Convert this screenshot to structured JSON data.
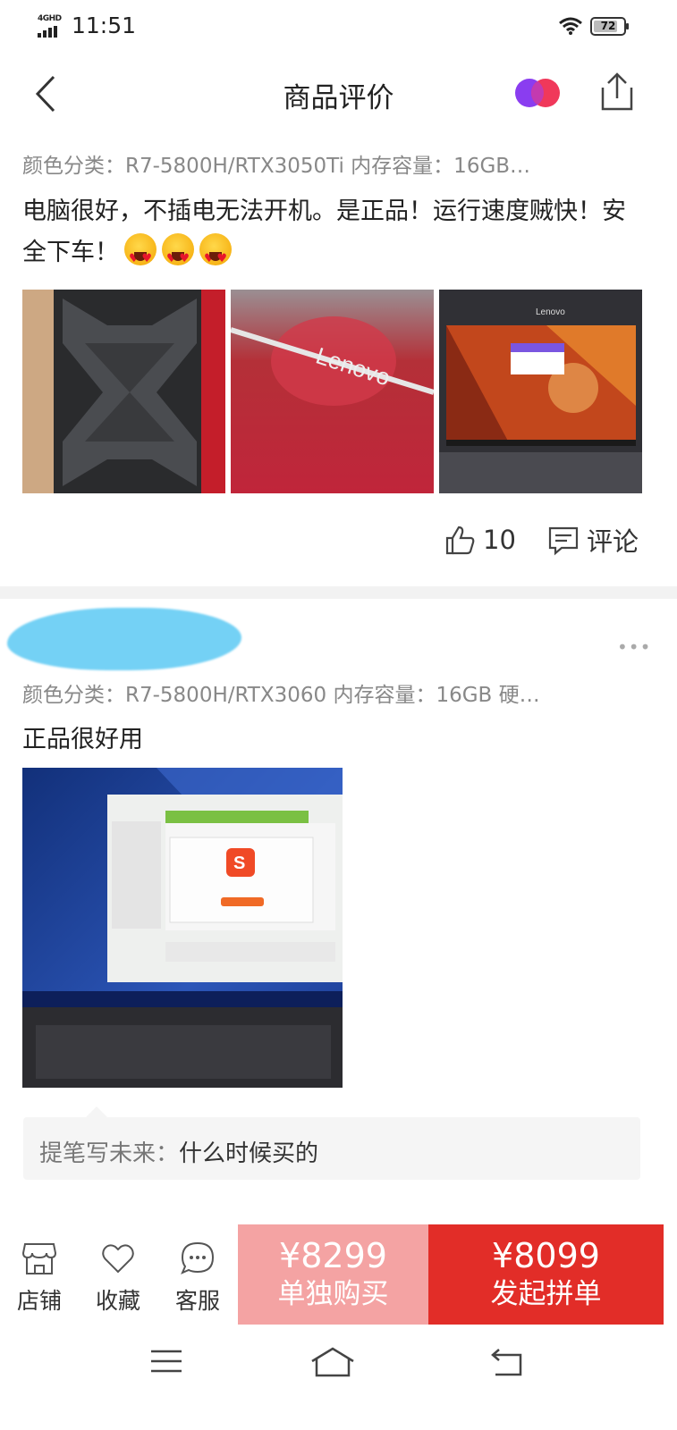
{
  "status": {
    "network": "4GHD",
    "time": "11:51",
    "battery": "72"
  },
  "header": {
    "title": "商品评价",
    "back_icon": "chevron-left-icon",
    "brand_icon": "overlapping-circles-icon",
    "share_icon": "share-icon"
  },
  "reviews": [
    {
      "variant": "颜色分类：R7-5800H/RTX3050Ti  内存容量：16GB…",
      "text": "电脑很好，不插电无法开机。是正品！运行速度贼快！安全下车！",
      "emojis": [
        "heart-eyes-emoji",
        "heart-eyes-emoji",
        "heart-eyes-emoji"
      ],
      "photos": [
        {
          "desc": "laptop box packaging"
        },
        {
          "desc": "Lenovo logo close-up",
          "text": "Lenovo"
        },
        {
          "desc": "laptop screen with wallpaper",
          "text": "Lenovo"
        }
      ],
      "likes": "10",
      "comment_label": "评论"
    },
    {
      "variant": "颜色分类：R7-5800H/RTX3060  内存容量：16GB  硬…",
      "text": "正品很好用",
      "photos": [
        {
          "desc": "laptop screen showing installer"
        }
      ],
      "reply": {
        "user": "提笔写未来：",
        "content": "什么时候买的"
      }
    }
  ],
  "bottom_bar": {
    "store_label": "店铺",
    "favorite_label": "收藏",
    "service_label": "客服",
    "solo_price": "¥8299",
    "solo_label": "单独购买",
    "group_price": "¥8099",
    "group_label": "发起拼单",
    "colors": {
      "solo": "#f4a3a3",
      "group": "#e22d28"
    }
  }
}
